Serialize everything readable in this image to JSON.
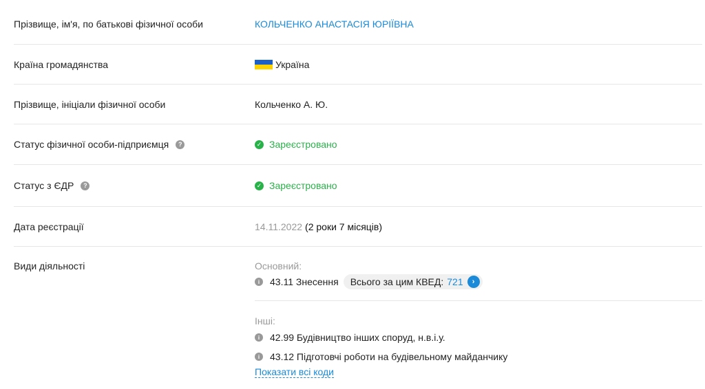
{
  "rows": {
    "full_name": {
      "label": "Прізвище, ім'я, по батькові фізичної особи",
      "value": "КОЛЬЧЕНКО АНАСТАСІЯ ЮРІЇВНА"
    },
    "country": {
      "label": "Країна громадянства",
      "value": "Україна",
      "flag_colors": [
        "#1c5fc6",
        "#fcd200"
      ]
    },
    "short_name": {
      "label": "Прізвище, ініціали фізичної особи",
      "value": "Кольченко А. Ю."
    },
    "fop_status": {
      "label": "Статус фізичної особи-підприємця",
      "help": "?",
      "value": "Зареєстровано"
    },
    "edr_status": {
      "label": "Статус з ЄДР",
      "help": "?",
      "value": "Зареєстровано"
    },
    "reg_date": {
      "label": "Дата реєстрації",
      "date": "14.11.2022",
      "duration": "(2 роки 7 місяців)"
    },
    "activities": {
      "label": "Види діяльності",
      "main_label": "Основний:",
      "main": {
        "code_text": "43.11 Знесення",
        "pill_label": "Всього за цим КВЕД:",
        "pill_count": "721"
      },
      "others_label": "Інші:",
      "others": [
        "42.99 Будівництво інших споруд, н.в.і.у.",
        "43.12 Підготовчі роботи на будівельному майданчику"
      ],
      "show_all": "Показати всі коди"
    }
  },
  "colors": {
    "accent": "#1a8ad9",
    "success": "#2ab24a",
    "muted": "#999999",
    "divider": "#e6e6e6"
  }
}
